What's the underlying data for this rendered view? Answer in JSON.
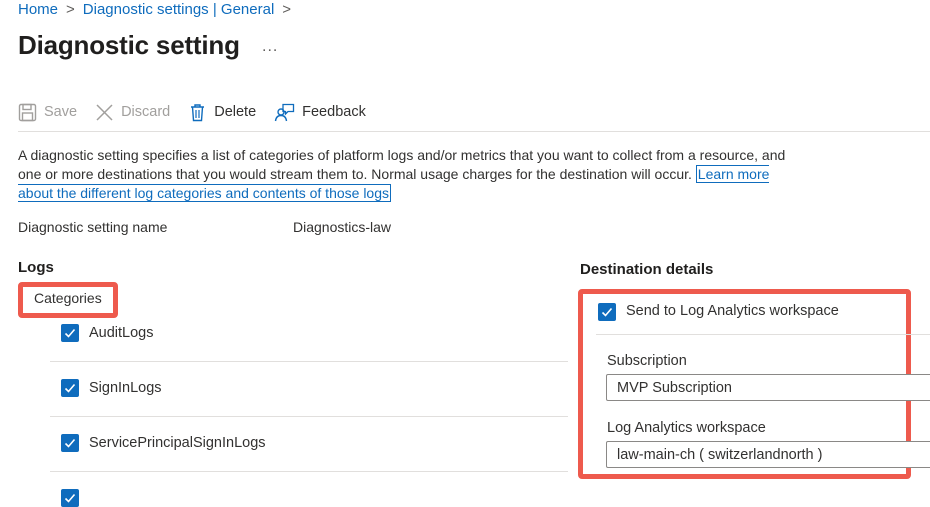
{
  "breadcrumb": {
    "items": [
      "Home",
      "Diagnostic settings | General"
    ],
    "separator": ">"
  },
  "page": {
    "title": "Diagnostic setting",
    "more": "..."
  },
  "toolbar": {
    "save_label": "Save",
    "discard_label": "Discard",
    "delete_label": "Delete",
    "feedback_label": "Feedback"
  },
  "description": {
    "text": "A diagnostic setting specifies a list of categories of platform logs and/or metrics that you want to collect from a resource, and one or more destinations that you would stream them to. Normal usage charges for the destination will occur.",
    "link": "Learn more about the different log categories and contents of those logs"
  },
  "setting_name": {
    "label": "Diagnostic setting name",
    "value": "Diagnostics-law"
  },
  "logs": {
    "heading": "Logs",
    "categories_label": "Categories",
    "items": [
      {
        "label": "AuditLogs",
        "checked": true
      },
      {
        "label": "SignInLogs",
        "checked": true
      },
      {
        "label": "ServicePrincipalSignInLogs",
        "checked": true
      },
      {
        "label": "",
        "checked": true
      }
    ]
  },
  "destination": {
    "heading": "Destination details",
    "law_checkbox": {
      "label": "Send to Log Analytics workspace",
      "checked": true
    },
    "subscription": {
      "label": "Subscription",
      "value": "MVP Subscription"
    },
    "workspace": {
      "label": "Log Analytics workspace",
      "value": "law-main-ch ( switzerlandnorth )"
    }
  },
  "colors": {
    "accent": "#0f6cbd",
    "highlight": "#ee5a4d",
    "disabled": "#a19f9d"
  }
}
